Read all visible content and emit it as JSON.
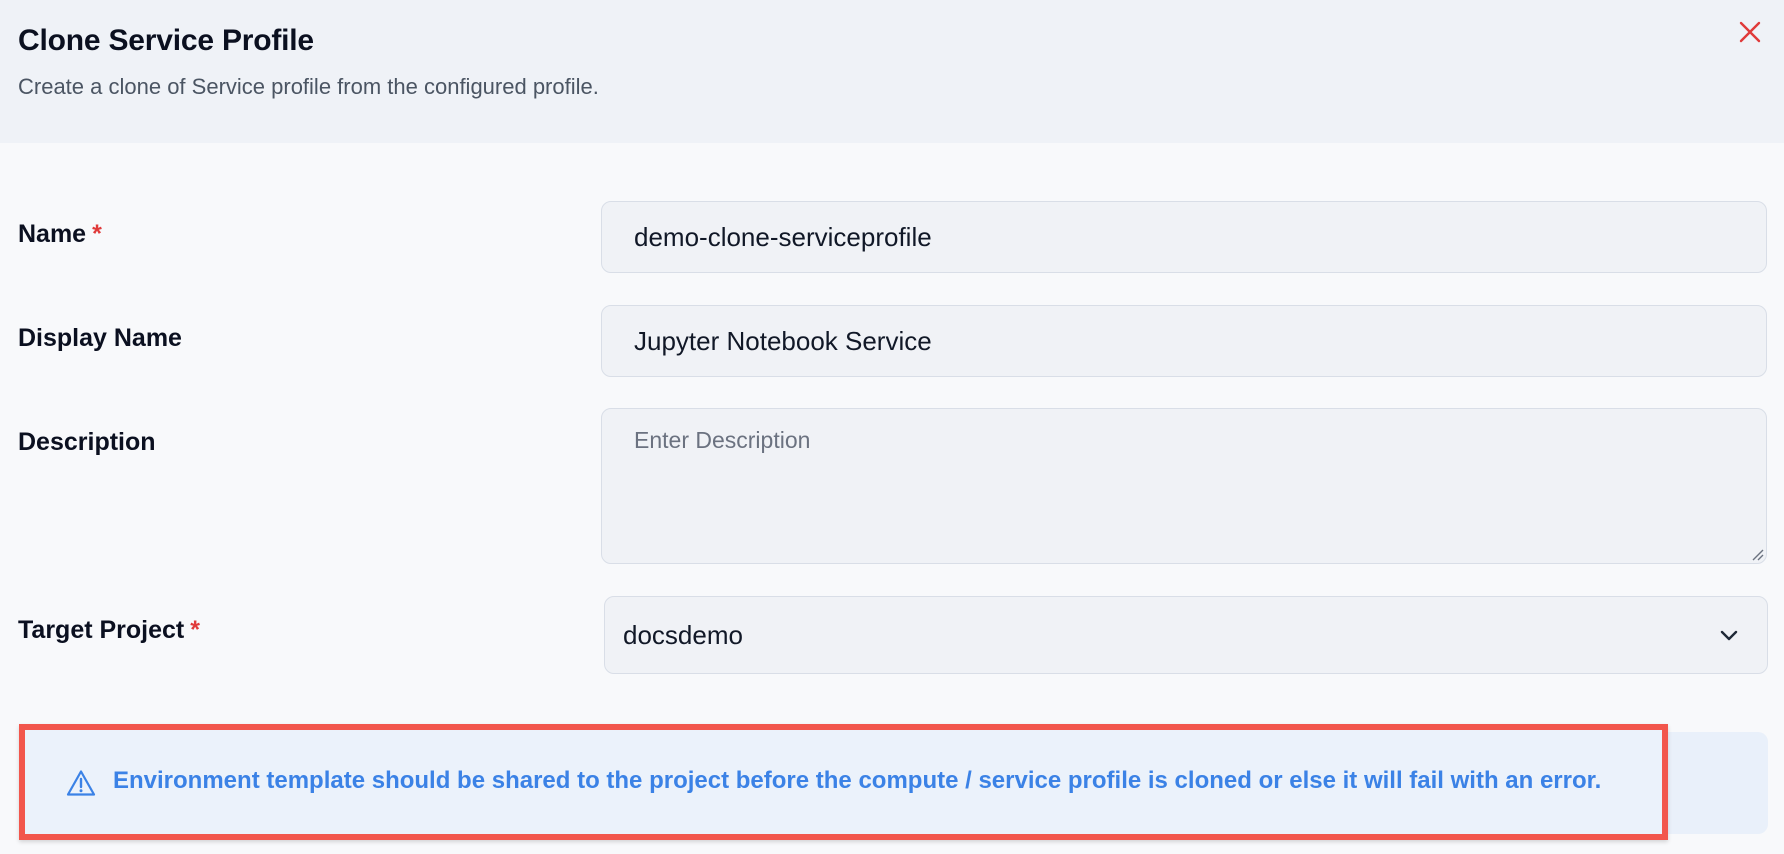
{
  "dialog": {
    "title": "Clone Service Profile",
    "subtitle": "Create a clone of Service profile from the configured profile.",
    "close_icon": "close-icon"
  },
  "form": {
    "name": {
      "label": "Name",
      "required_mark": "*",
      "value": "demo-clone-serviceprofile"
    },
    "display_name": {
      "label": "Display Name",
      "value": "Jupyter Notebook Service"
    },
    "description": {
      "label": "Description",
      "placeholder": "Enter Description",
      "value": ""
    },
    "target_project": {
      "label": "Target Project",
      "required_mark": "*",
      "value": "docsdemo"
    }
  },
  "alert": {
    "icon": "warning-icon",
    "text": "Environment template should be shared to the project before the compute / service profile is cloned or else it will fail with an error."
  },
  "colors": {
    "required": "#e03a3a",
    "alert_text": "#3b82e6",
    "highlight_border": "#f2564c",
    "close_icon": "#e03a3a"
  }
}
